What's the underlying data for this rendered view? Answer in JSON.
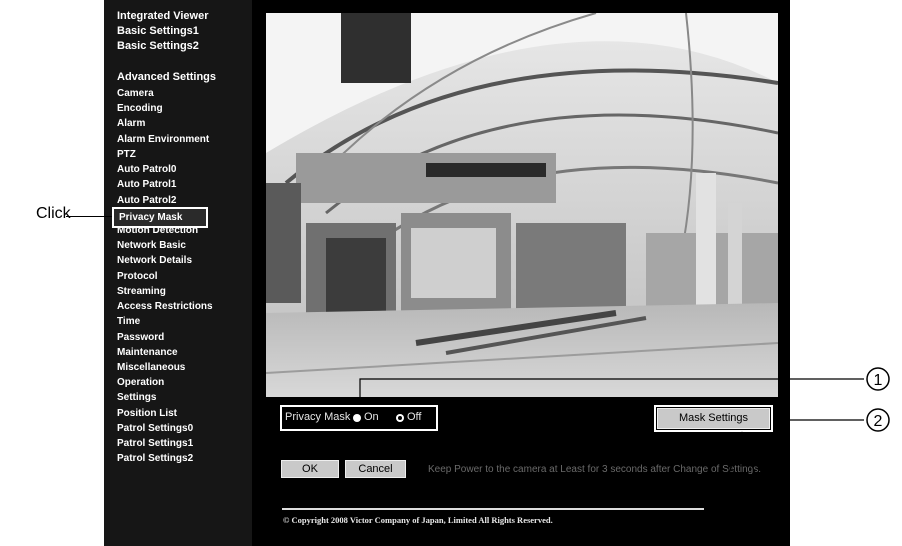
{
  "sidebar": {
    "top_links": [
      "Integrated Viewer",
      "Basic Settings1",
      "Basic Settings2"
    ],
    "section_title": "Advanced Settings",
    "items": [
      "Camera",
      "Encoding",
      "Alarm",
      "Alarm Environment",
      "PTZ",
      "Auto Patrol0",
      "Auto Patrol1",
      "Auto Patrol2",
      "Privacy Mask",
      "Motion Detection",
      "Network Basic",
      "Network Details",
      "Protocol",
      "Streaming",
      "Access Restrictions",
      "Time",
      "Password",
      "Maintenance",
      "Miscellaneous",
      "Operation",
      "Settings",
      "Position List",
      "Patrol Settings0",
      "Patrol Settings1",
      "Patrol Settings2"
    ],
    "selected": "Privacy Mask"
  },
  "annotation": {
    "click_label": "Click",
    "callout_1": "1",
    "callout_2": "2"
  },
  "privacy_mask": {
    "label": "Privacy Mask",
    "on_label": "On",
    "off_label": "Off",
    "selected": "Off"
  },
  "buttons": {
    "mask_settings": "Mask Settings",
    "ok": "OK",
    "cancel": "Cancel"
  },
  "note": "Keep Power to the camera at Least for 3 seconds after Change of Settings.",
  "copyright": "© Copyright 2008 Victor Company of Japan, Limited All Rights Reserved."
}
